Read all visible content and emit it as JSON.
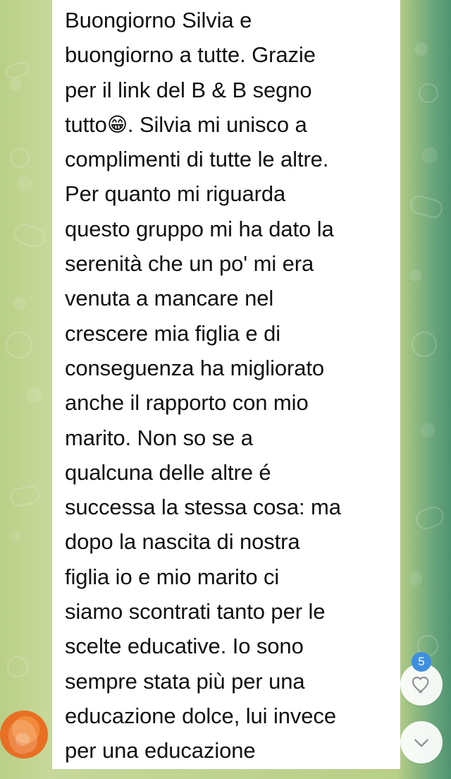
{
  "message": {
    "lines": [
      "Buongiorno Silvia e",
      "buongiorno a tutte. Grazie",
      "per il link del B & B segno",
      "tutto",
      "😁",
      ". Silvia mi unisco a",
      "complimenti di tutte le altre.",
      "Per quanto mi riguarda",
      "questo gruppo mi ha dato la",
      "serenità che un po' mi era",
      "venuta a mancare nel",
      "crescere mia figlia e di",
      "conseguenza ha migliorato",
      "anche il rapporto con mio",
      "marito. Non so se a",
      "qualcuna delle altre é",
      "successa la stessa cosa: ma",
      "dopo la nascita di nostra",
      "figlia io e mio marito ci",
      "siamo scontrati tanto per le",
      "scelte educative. Io sono",
      "sempre stata più per una",
      "educazione dolce, lui invece",
      "per una educazione"
    ]
  },
  "reaction": {
    "count": "5",
    "icon": "heart-outline-icon"
  },
  "navigation": {
    "scroll_icon": "chevron-down-icon"
  },
  "colors": {
    "badge": "#3f8fe0",
    "bubble": "#ffffff",
    "text": "#111111"
  }
}
